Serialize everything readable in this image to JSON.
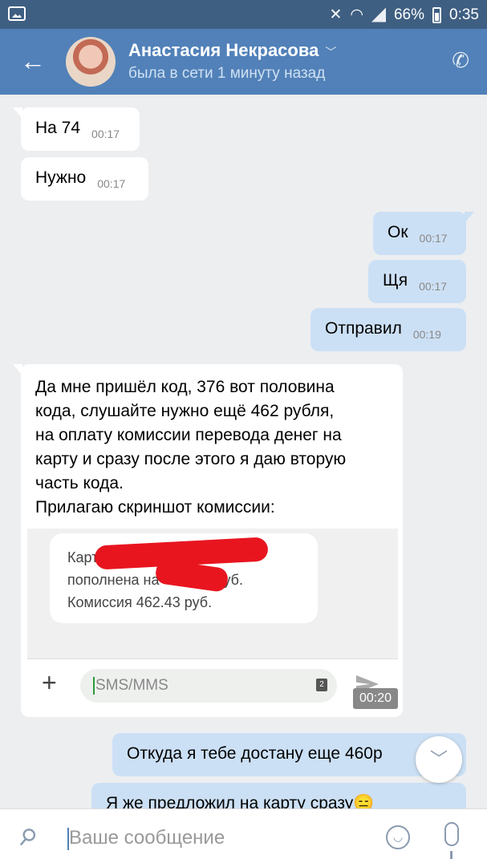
{
  "statusbar": {
    "battery": "66%",
    "time": "0:35"
  },
  "header": {
    "name": "Анастасия Некрасова",
    "status": "была в сети 1 минуту назад"
  },
  "messages": [
    {
      "dir": "in",
      "text": "На 74",
      "time": "00:17"
    },
    {
      "dir": "in",
      "text": "Нужно",
      "time": "00:17"
    },
    {
      "dir": "out",
      "text": "Ок",
      "time": "00:17"
    },
    {
      "dir": "out",
      "text": "Щя",
      "time": "00:17"
    },
    {
      "dir": "out",
      "text": "Отправил",
      "time": "00:19"
    }
  ],
  "long_message": {
    "text": "Да мне пришёл код, 376 вот половина\nкода, слушайте нужно ещё 462 рубля,\nна оплату комиссии перевода денег на\nкарту и сразу после этого я даю вторую\nчасть кода.\nПрилагаю скриншот комиссии:",
    "screenshot": {
      "line1": "Карт",
      "line2a": "пополнена на",
      "line2b": "уб.",
      "line3": "Комиссия 462.43 руб.",
      "placeholder": "SMS/MMS",
      "sim": "2",
      "time": "00:20"
    }
  },
  "out_last": [
    {
      "text": "Откуда я тебе достану еще 460р"
    },
    {
      "text": "Я же предложил на карту сразу😑"
    }
  ],
  "composer": {
    "placeholder": "Ваше сообщение"
  }
}
